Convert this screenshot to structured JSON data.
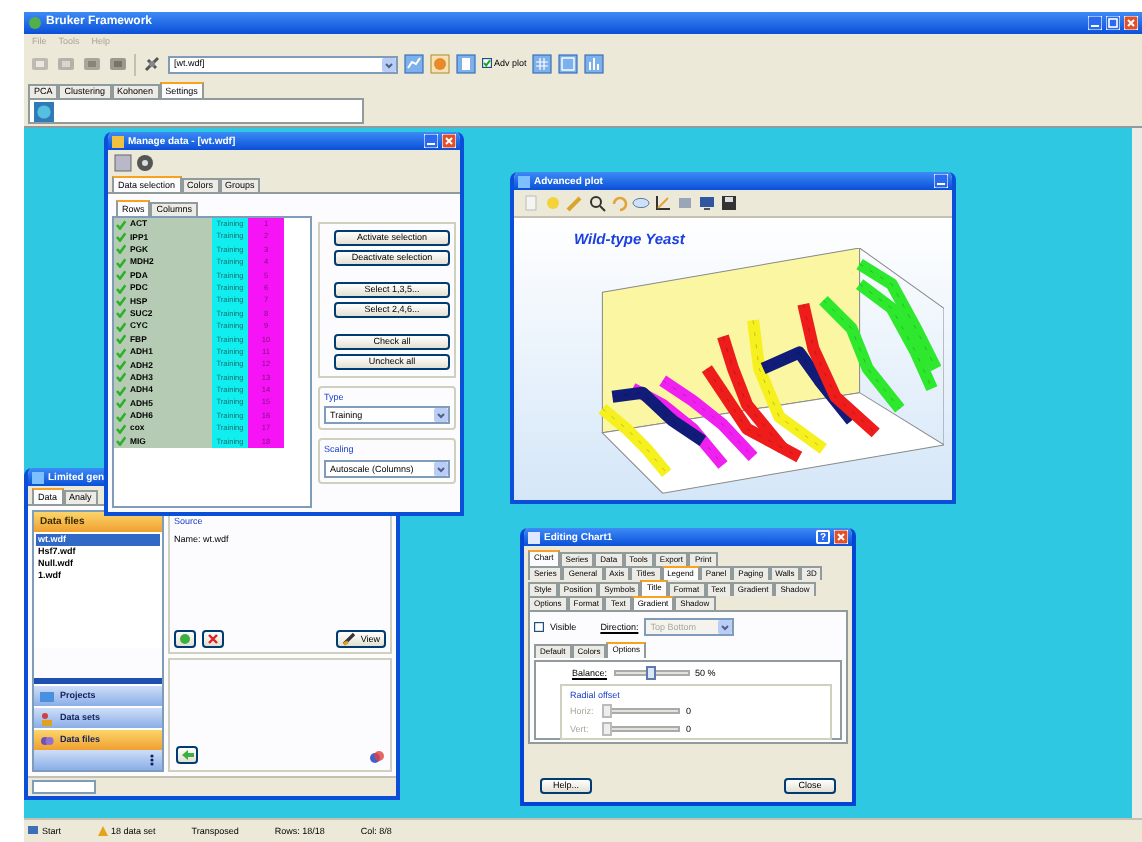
{
  "window": {
    "title": "Bruker Framework"
  },
  "menu": [
    "File",
    "Tools",
    "Help"
  ],
  "toolbar": {
    "dataset": "[wt.wdf]",
    "adv_plot": {
      "label": "Adv plot",
      "checked": true
    }
  },
  "tabs": [
    {
      "label": "PCA",
      "selected": false
    },
    {
      "label": "Clustering",
      "selected": false
    },
    {
      "label": "Kohonen",
      "selected": false
    },
    {
      "label": "Settings",
      "selected": true
    }
  ],
  "files_window": {
    "title": "Limited gen",
    "tabs": [
      {
        "label": "Data",
        "selected": true
      },
      {
        "label": "Analy",
        "selected": false
      }
    ],
    "list_header": "Data files",
    "files": [
      {
        "label": "wt.wdf",
        "selected": true
      },
      {
        "label": "Hsf7.wdf",
        "selected": false
      },
      {
        "label": "Null.wdf",
        "selected": false
      },
      {
        "label": "1.wdf",
        "selected": false
      }
    ],
    "source_label": "Source",
    "source_name": "Name: wt.wdf",
    "view_button": "View",
    "nav": [
      {
        "label": "Projects",
        "selected": false
      },
      {
        "label": "Data sets",
        "selected": false
      },
      {
        "label": "Data files",
        "selected": true
      }
    ]
  },
  "manage_window": {
    "title": "Manage data - [wt.wdf]",
    "tabs": [
      {
        "label": "Data selection",
        "selected": true
      },
      {
        "label": "Colors",
        "selected": false
      },
      {
        "label": "Groups",
        "selected": false
      }
    ],
    "subtabs": [
      {
        "label": "Rows",
        "selected": true
      },
      {
        "label": "Columns",
        "selected": false
      }
    ],
    "rows": [
      {
        "name": "ACT",
        "checked": true,
        "type": "Training",
        "group": "1"
      },
      {
        "name": "IPP1",
        "checked": true,
        "type": "Training",
        "group": "2"
      },
      {
        "name": "PGK",
        "checked": true,
        "type": "Training",
        "group": "3"
      },
      {
        "name": "MDH2",
        "checked": true,
        "type": "Training",
        "group": "4"
      },
      {
        "name": "PDA",
        "checked": true,
        "type": "Training",
        "group": "5"
      },
      {
        "name": "PDC",
        "checked": true,
        "type": "Training",
        "group": "6"
      },
      {
        "name": "HSP",
        "checked": true,
        "type": "Training",
        "group": "7"
      },
      {
        "name": "SUC2",
        "checked": true,
        "type": "Training",
        "group": "8"
      },
      {
        "name": "CYC",
        "checked": true,
        "type": "Training",
        "group": "9"
      },
      {
        "name": "FBP",
        "checked": true,
        "type": "Training",
        "group": "10"
      },
      {
        "name": "ADH1",
        "checked": true,
        "type": "Training",
        "group": "11"
      },
      {
        "name": "ADH2",
        "checked": true,
        "type": "Training",
        "group": "12"
      },
      {
        "name": "ADH3",
        "checked": true,
        "type": "Training",
        "group": "13"
      },
      {
        "name": "ADH4",
        "checked": true,
        "type": "Training",
        "group": "14"
      },
      {
        "name": "ADH5",
        "checked": true,
        "type": "Training",
        "group": "15"
      },
      {
        "name": "ADH6",
        "checked": true,
        "type": "Training",
        "group": "16"
      },
      {
        "name": "cox",
        "checked": true,
        "type": "Training",
        "group": "17"
      },
      {
        "name": "MIG",
        "checked": true,
        "type": "Training",
        "group": "18"
      }
    ],
    "buttons": [
      "Activate selection",
      "Deactivate selection",
      "Select 1,3,5...",
      "Select 2,4,6...",
      "Check all",
      "Uncheck all"
    ],
    "type": {
      "label": "Type",
      "value": "Training"
    },
    "scaling": {
      "label": "Scaling",
      "value": "Autoscale (Columns)"
    }
  },
  "plot_window": {
    "title": "Advanced plot",
    "plot_title": "Wild-type Yeast"
  },
  "chart_editor": {
    "title": "Editing Chart1",
    "help_glyph": "?",
    "tab_rows": [
      [
        {
          "label": "Chart",
          "selected": true
        },
        {
          "label": "Series",
          "selected": false
        },
        {
          "label": "Data",
          "selected": false
        },
        {
          "label": "Tools",
          "selected": false
        },
        {
          "label": "Export",
          "selected": false
        },
        {
          "label": "Print",
          "selected": false
        }
      ],
      [
        {
          "label": "Series",
          "selected": false
        },
        {
          "label": "General",
          "selected": false
        },
        {
          "label": "Axis",
          "selected": false
        },
        {
          "label": "Titles",
          "selected": false
        },
        {
          "label": "Legend",
          "selected": true
        },
        {
          "label": "Panel",
          "selected": false
        },
        {
          "label": "Paging",
          "selected": false
        },
        {
          "label": "Walls",
          "selected": false
        },
        {
          "label": "3D",
          "selected": false
        }
      ],
      [
        {
          "label": "Style",
          "selected": false
        },
        {
          "label": "Position",
          "selected": false
        },
        {
          "label": "Symbols",
          "selected": false
        },
        {
          "label": "Title",
          "selected": true
        },
        {
          "label": "Format",
          "selected": false
        },
        {
          "label": "Text",
          "selected": false
        },
        {
          "label": "Gradient",
          "selected": false
        },
        {
          "label": "Shadow",
          "selected": false
        }
      ],
      [
        {
          "label": "Options",
          "selected": false
        },
        {
          "label": "Format",
          "selected": false
        },
        {
          "label": "Text",
          "selected": false
        },
        {
          "label": "Gradient",
          "selected": true
        },
        {
          "label": "Shadow",
          "selected": false
        }
      ]
    ],
    "visible": {
      "label": "Visible",
      "checked": false
    },
    "direction": {
      "label": "Direction:",
      "value": "Top Bottom",
      "disabled": true
    },
    "subtabs": [
      {
        "label": "Default",
        "selected": false
      },
      {
        "label": "Colors",
        "selected": false
      },
      {
        "label": "Options",
        "selected": true
      }
    ],
    "balance": {
      "label": "Balance:",
      "level": 0.5,
      "reading": "50 %"
    },
    "radial_offset": {
      "label": "Radial offset",
      "fields": [
        {
          "label": "Horiz:",
          "reading": "0"
        },
        {
          "label": "Vert:",
          "reading": "0"
        }
      ]
    },
    "buttons": [
      "Help...",
      "Close"
    ]
  },
  "status_bar": [
    "Start",
    "18 data set",
    "Transposed",
    "Rows: 18/18",
    "Col: 8/8"
  ]
}
